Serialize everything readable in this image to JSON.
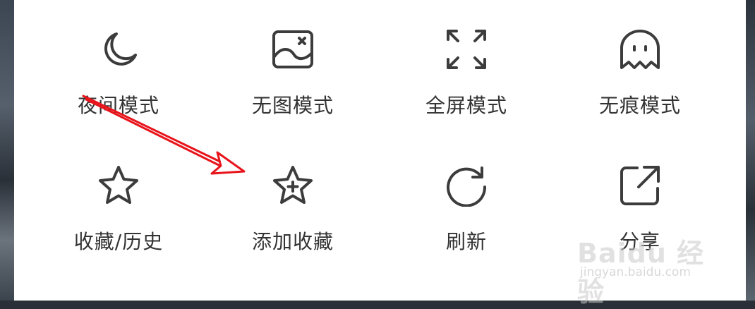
{
  "menu": {
    "row1": [
      {
        "label": "夜间模式",
        "icon": "moon-icon"
      },
      {
        "label": "无图模式",
        "icon": "no-image-icon"
      },
      {
        "label": "全屏模式",
        "icon": "fullscreen-icon"
      },
      {
        "label": "无痕模式",
        "icon": "ghost-icon"
      }
    ],
    "row2": [
      {
        "label": "收藏/历史",
        "icon": "star-icon"
      },
      {
        "label": "添加收藏",
        "icon": "star-plus-icon"
      },
      {
        "label": "刷新",
        "icon": "refresh-icon"
      },
      {
        "label": "分享",
        "icon": "share-icon"
      }
    ]
  },
  "annotation": {
    "arrow_color": "#e8141b"
  },
  "watermark": {
    "brand": "Baidu 经验",
    "url": "jingyan.baidu.com"
  },
  "colors": {
    "icon": "#3c3c3c",
    "text": "#333333",
    "panel": "#ffffff"
  }
}
